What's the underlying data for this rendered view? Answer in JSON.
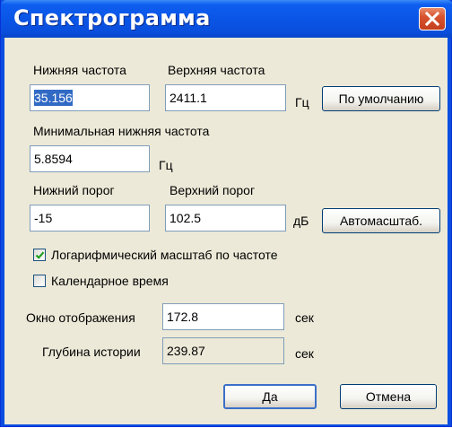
{
  "window": {
    "title": "Спектрограмма",
    "close_icon": "close-icon"
  },
  "labels": {
    "low_freq": "Нижняя частота",
    "high_freq": "Верхняя частота",
    "hz_1": "Гц",
    "min_low_freq": "Минимальная нижняя частота",
    "hz_2": "Гц",
    "low_threshold": "Нижний порог",
    "high_threshold": "Верхний порог",
    "db": "дБ",
    "display_window": "Окно отображения",
    "sec_1": "сек",
    "history_depth": "Глубина истории",
    "sec_2": "сек"
  },
  "fields": {
    "low_freq": "35.156",
    "high_freq": "2411.1",
    "min_low_freq": "5.8594",
    "low_threshold": "-15",
    "high_threshold": "102.5",
    "display_window": "172.8",
    "history_depth": "239.87"
  },
  "checkboxes": {
    "log_scale": {
      "label": "Логарифмический масштаб по частоте",
      "checked": true
    },
    "calendar_time": {
      "label": "Календарное время",
      "checked": false
    }
  },
  "buttons": {
    "default": "По умолчанию",
    "autoscale": "Автомасштаб.",
    "ok": "Да",
    "cancel": "Отмена"
  }
}
